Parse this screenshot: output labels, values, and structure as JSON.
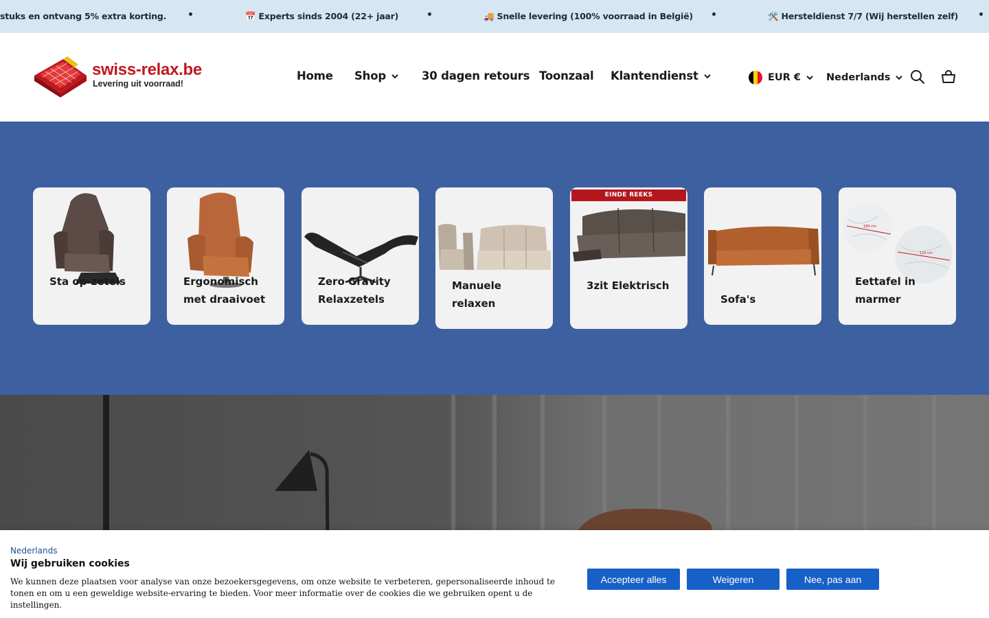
{
  "announcement": {
    "items": [
      "stuks en ontvang 5% extra korting.",
      "📅 Experts sinds 2004 (22+ jaar)",
      "🚚 Snelle levering (100% voorraad in België)",
      "🛠️ Hersteldienst 7/7 (Wij herstellen zelf)"
    ],
    "separator": "•"
  },
  "header": {
    "logo_text": "swiss-relax.be",
    "logo_tagline": "Levering uit voorraad!",
    "nav": [
      {
        "label": "Home",
        "has_dropdown": false
      },
      {
        "label": "Shop",
        "has_dropdown": true
      },
      {
        "label": "30 dagen retours",
        "has_dropdown": false
      },
      {
        "label": "Toonzaal",
        "has_dropdown": false
      },
      {
        "label": "Klantendienst",
        "has_dropdown": true
      }
    ],
    "currency": "EUR €",
    "language": "Nederlands",
    "icons": [
      "search-icon",
      "cart-icon"
    ]
  },
  "categories": {
    "background_color": "#3d60a0",
    "items": [
      {
        "label": "Sta op-zetels",
        "ribbon": null
      },
      {
        "label": "Ergonomisch met draaivoet",
        "ribbon": null
      },
      {
        "label": "Zero Gravity Relaxzetels",
        "ribbon": null
      },
      {
        "label": "Manuele relaxen",
        "ribbon": null
      },
      {
        "label": "3zit Elektrisch",
        "ribbon": "EINDE REEKS"
      },
      {
        "label": "Sofa's",
        "ribbon": null
      },
      {
        "label": "Eettafel in marmer",
        "ribbon": null
      }
    ],
    "table_dims": [
      "180 cm",
      "120 cm"
    ]
  },
  "cookie_banner": {
    "language_link": "Nederlands",
    "title": "Wij gebruiken cookies",
    "text": "We kunnen deze plaatsen voor analyse van onze bezoekersgegevens, om onze website te verbeteren, gepersonaliseerde inhoud te tonen en om u een geweldige website-ervaring te bieden. Voor meer informatie over de cookies die we gebruiken opent u de instellingen.",
    "buttons": {
      "accept": "Accepteer alles",
      "reject": "Weigeren",
      "customize": "Nee, pas aan"
    },
    "button_color": "#1760c8"
  }
}
